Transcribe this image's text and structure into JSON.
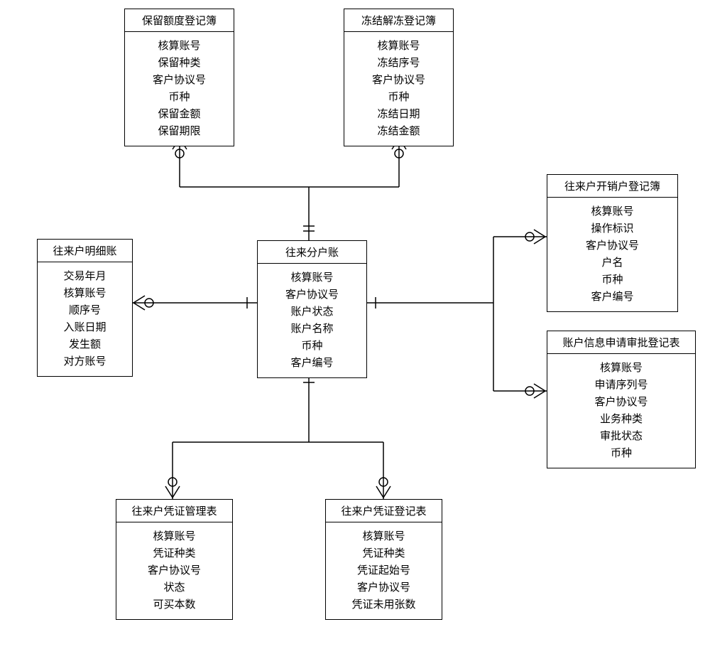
{
  "center": {
    "title": "往来分户账",
    "fields": [
      "核算账号",
      "客户协议号",
      "账户状态",
      "账户名称",
      "币种",
      "客户编号"
    ]
  },
  "topLeft": {
    "title": "保留额度登记簿",
    "fields": [
      "核算账号",
      "保留种类",
      "客户协议号",
      "币种",
      "保留金额",
      "保留期限"
    ]
  },
  "topRight": {
    "title": "冻结解冻登记簿",
    "fields": [
      "核算账号",
      "冻结序号",
      "客户协议号",
      "币种",
      "冻结日期",
      "冻结金额"
    ]
  },
  "left": {
    "title": "往来户明细账",
    "fields": [
      "交易年月",
      "核算账号",
      "顺序号",
      "入账日期",
      "发生额",
      "对方账号"
    ]
  },
  "right1": {
    "title": "往来户开销户登记簿",
    "fields": [
      "核算账号",
      "操作标识",
      "客户协议号",
      "户名",
      "币种",
      "客户编号"
    ]
  },
  "right2": {
    "title": "账户信息申请审批登记表",
    "fields": [
      "核算账号",
      "申请序列号",
      "客户协议号",
      "业务种类",
      "审批状态",
      "币种"
    ]
  },
  "bottomLeft": {
    "title": "往来户凭证管理表",
    "fields": [
      "核算账号",
      "凭证种类",
      "客户协议号",
      "状态",
      "可买本数"
    ]
  },
  "bottomRight": {
    "title": "往来户凭证登记表",
    "fields": [
      "核算账号",
      "凭证种类",
      "凭证起始号",
      "客户协议号",
      "凭证未用张数"
    ]
  }
}
